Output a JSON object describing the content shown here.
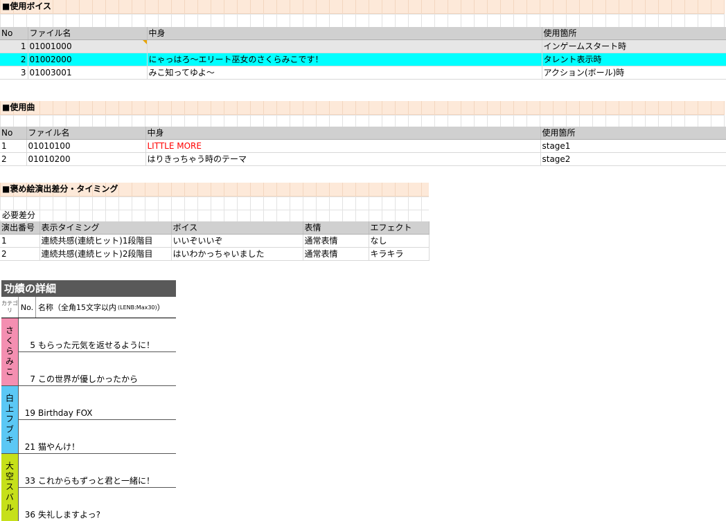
{
  "voice": {
    "title": "■使用ボイス",
    "headers": [
      "No",
      "ファイル名",
      "中身",
      "使用箇所"
    ],
    "rows": [
      {
        "no": "1",
        "file": "01001000",
        "content": "",
        "usage": "インゲームスタート時"
      },
      {
        "no": "2",
        "file": "01002000",
        "content": "にゃっはろ～エリート巫女のさくらみこです！",
        "usage": "タレント表示時"
      },
      {
        "no": "3",
        "file": "01003001",
        "content": "みこ知ってゆよ～",
        "usage": "アクション(ボール)時"
      }
    ]
  },
  "music": {
    "title": "■使用曲",
    "headers": [
      "No",
      "ファイル名",
      "中身",
      "使用箇所"
    ],
    "rows": [
      {
        "no": "1",
        "file": "01010100",
        "content": "LITTLE MORE",
        "usage": "stage1"
      },
      {
        "no": "2",
        "file": "01010200",
        "content": "はりきっちゃう時のテーマ",
        "usage": "stage2"
      }
    ]
  },
  "praise": {
    "title": "■褒め絵演出差分・タイミング",
    "note": "必要差分",
    "headers": [
      "演出番号",
      "表示タイミング",
      "ボイス",
      "表情",
      "エフェクト"
    ],
    "rows": [
      {
        "no": "1",
        "timing": "連続共感(連続ヒット)1段階目",
        "voice": "いいぞいいぞ",
        "face": "通常表情",
        "effect": "なし"
      },
      {
        "no": "2",
        "timing": "連続共感(連続ヒット)2段階目",
        "voice": "はいわかっちゃいました",
        "face": "通常表情",
        "effect": "キラキラ"
      }
    ]
  },
  "achievements": {
    "title": "功績の詳細",
    "header_category": "カテゴリ",
    "header_no": "No.",
    "header_name": "名称（全角15文字以内",
    "header_name_small": "(LENB:Max30)",
    "header_name_end": "）",
    "colors": {
      "sakura": "#f48fb1",
      "fubuki": "#5bc8f5",
      "subaru": "#c6e01a"
    },
    "groups": [
      {
        "category": "さくらみこ",
        "items": [
          {
            "no": "5",
            "name": "もらった元気を返せるように！"
          },
          {
            "no": "7",
            "name": "この世界が優しかったから"
          }
        ]
      },
      {
        "category": "白上フブキ",
        "items": [
          {
            "no": "19",
            "name": "Birthday FOX"
          },
          {
            "no": "21",
            "name": "猫やんけ！"
          }
        ]
      },
      {
        "category": "大空スバル",
        "items": [
          {
            "no": "33",
            "name": "これからもずっと君と一緒に！"
          },
          {
            "no": "36",
            "name": "失礼しますよっ?"
          }
        ]
      }
    ]
  }
}
